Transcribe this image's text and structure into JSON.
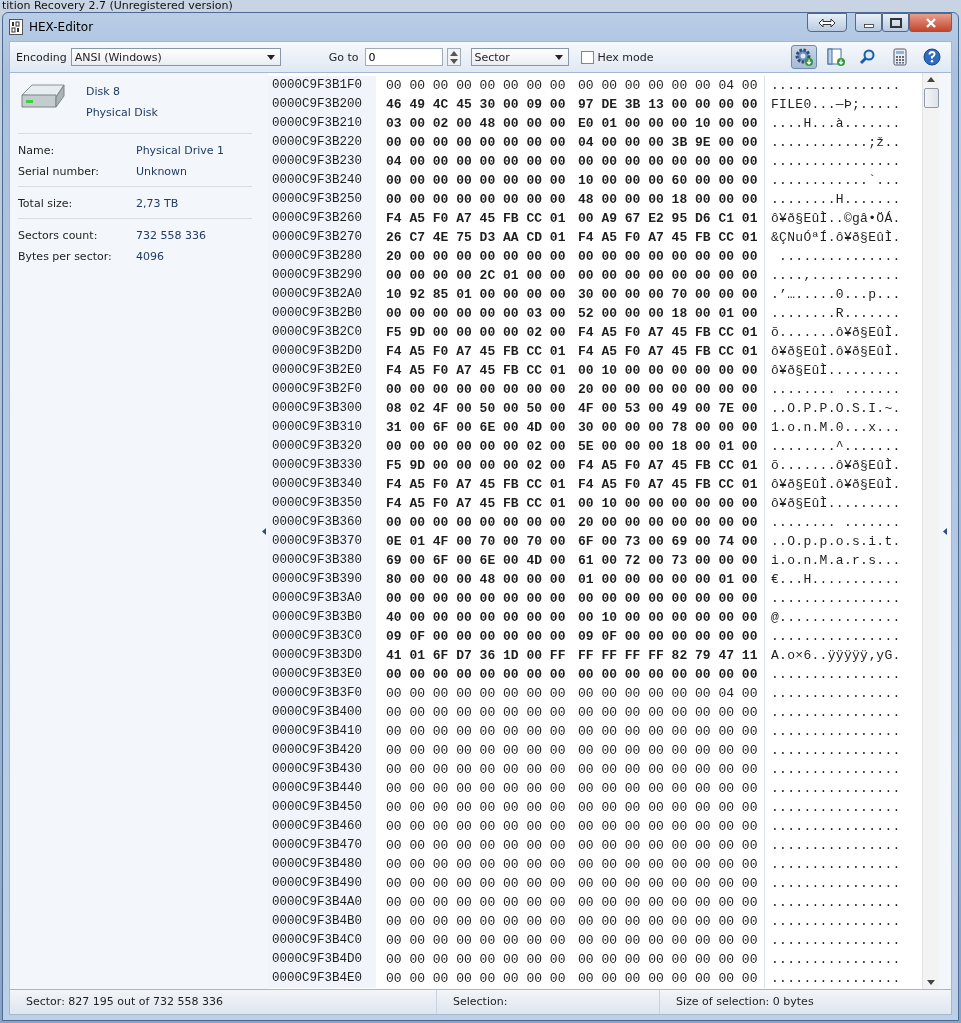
{
  "background_window_title": "tition Recovery 2.7 (Unregistered version)",
  "window": {
    "title": "HEX-Editor"
  },
  "toolbar": {
    "encoding_label": "Encoding",
    "encoding_value": "ANSI (Windows)",
    "goto_label": "Go to",
    "goto_value": "0",
    "unit_value": "Sector",
    "hex_mode": {
      "label": "Hex mode",
      "checked": false
    },
    "icons": [
      {
        "kind": "gear",
        "selected": true
      },
      {
        "kind": "panel",
        "selected": false
      },
      {
        "kind": "search",
        "selected": false
      },
      {
        "kind": "calculator",
        "selected": false
      },
      {
        "kind": "help",
        "selected": false
      }
    ]
  },
  "disk": {
    "title": "Disk 8",
    "subtitle": "Physical Disk",
    "groups": [
      [
        {
          "label": "Name:",
          "value": "Physical Drive 1"
        },
        {
          "label": "Serial number:",
          "value": "Unknown"
        }
      ],
      [
        {
          "label": "Total size:",
          "value": "2,73 TB"
        }
      ],
      [
        {
          "label": "Sectors count:",
          "value": "732 558 336"
        },
        {
          "label": "Bytes per sector:",
          "value": "4096"
        }
      ]
    ]
  },
  "hex_rows": [
    {
      "offset": "0000C9F3B1F0",
      "hex_1": "00 00 00 00 00 00 00 00",
      "hex_2": "00 00 00 00 00 00 04 00",
      "text": "................",
      "bold": false
    },
    {
      "offset": "0000C9F3B200",
      "hex_1": "46 49 4C 45 30 00 09 00",
      "hex_2": "97 DE 3B 13 00 00 00 00",
      "text": "FILE0...—Þ;.....",
      "bold": true
    },
    {
      "offset": "0000C9F3B210",
      "hex_1": "03 00 02 00 48 00 00 00",
      "hex_2": "E0 01 00 00 00 10 00 00",
      "text": "....H...à.......",
      "bold": true
    },
    {
      "offset": "0000C9F3B220",
      "hex_1": "00 00 00 00 00 00 00 00",
      "hex_2": "04 00 00 00 3B 9E 00 00",
      "text": "............;ž..",
      "bold": true
    },
    {
      "offset": "0000C9F3B230",
      "hex_1": "04 00 00 00 00 00 00 00",
      "hex_2": "00 00 00 00 00 00 00 00",
      "text": "................",
      "bold": true
    },
    {
      "offset": "0000C9F3B240",
      "hex_1": "00 00 00 00 00 00 00 00",
      "hex_2": "10 00 00 00 60 00 00 00",
      "text": "............`...",
      "bold": true
    },
    {
      "offset": "0000C9F3B250",
      "hex_1": "00 00 00 00 00 00 00 00",
      "hex_2": "48 00 00 00 18 00 00 00",
      "text": "........H.......",
      "bold": true
    },
    {
      "offset": "0000C9F3B260",
      "hex_1": "F4 A5 F0 A7 45 FB CC 01",
      "hex_2": "00 A9 67 E2 95 D6 C1 01",
      "text": "ô¥ð§EûÌ..©gâ•ÖÁ.",
      "bold": true
    },
    {
      "offset": "0000C9F3B270",
      "hex_1": "26 C7 4E 75 D3 AA CD 01",
      "hex_2": "F4 A5 F0 A7 45 FB CC 01",
      "text": "&ÇNuÓªÍ.ô¥ð§EûÌ.",
      "bold": true
    },
    {
      "offset": "0000C9F3B280",
      "hex_1": "20 00 00 00 00 00 00 00",
      "hex_2": "00 00 00 00 00 00 00 00",
      "text": " ...............",
      "bold": true
    },
    {
      "offset": "0000C9F3B290",
      "hex_1": "00 00 00 00 2C 01 00 00",
      "hex_2": "00 00 00 00 00 00 00 00",
      "text": "....,...........",
      "bold": true
    },
    {
      "offset": "0000C9F3B2A0",
      "hex_1": "10 92 85 01 00 00 00 00",
      "hex_2": "30 00 00 00 70 00 00 00",
      "text": ".’….....0...p...",
      "bold": true
    },
    {
      "offset": "0000C9F3B2B0",
      "hex_1": "00 00 00 00 00 00 03 00",
      "hex_2": "52 00 00 00 18 00 01 00",
      "text": "........R.......",
      "bold": true
    },
    {
      "offset": "0000C9F3B2C0",
      "hex_1": "F5 9D 00 00 00 00 02 00",
      "hex_2": "F4 A5 F0 A7 45 FB CC 01",
      "text": "õ.......ô¥ð§EûÌ.",
      "bold": true
    },
    {
      "offset": "0000C9F3B2D0",
      "hex_1": "F4 A5 F0 A7 45 FB CC 01",
      "hex_2": "F4 A5 F0 A7 45 FB CC 01",
      "text": "ô¥ð§EûÌ.ô¥ð§EûÌ.",
      "bold": true
    },
    {
      "offset": "0000C9F3B2E0",
      "hex_1": "F4 A5 F0 A7 45 FB CC 01",
      "hex_2": "00 10 00 00 00 00 00 00",
      "text": "ô¥ð§EûÌ.........",
      "bold": true
    },
    {
      "offset": "0000C9F3B2F0",
      "hex_1": "00 00 00 00 00 00 00 00",
      "hex_2": "20 00 00 00 00 00 00 00",
      "text": "........ .......",
      "bold": true
    },
    {
      "offset": "0000C9F3B300",
      "hex_1": "08 02 4F 00 50 00 50 00",
      "hex_2": "4F 00 53 00 49 00 7E 00",
      "text": "..O.P.P.O.S.I.~.",
      "bold": true
    },
    {
      "offset": "0000C9F3B310",
      "hex_1": "31 00 6F 00 6E 00 4D 00",
      "hex_2": "30 00 00 00 78 00 00 00",
      "text": "1.o.n.M.0...x...",
      "bold": true
    },
    {
      "offset": "0000C9F3B320",
      "hex_1": "00 00 00 00 00 00 02 00",
      "hex_2": "5E 00 00 00 18 00 01 00",
      "text": "........^.......",
      "bold": true
    },
    {
      "offset": "0000C9F3B330",
      "hex_1": "F5 9D 00 00 00 00 02 00",
      "hex_2": "F4 A5 F0 A7 45 FB CC 01",
      "text": "õ.......ô¥ð§EûÌ.",
      "bold": true
    },
    {
      "offset": "0000C9F3B340",
      "hex_1": "F4 A5 F0 A7 45 FB CC 01",
      "hex_2": "F4 A5 F0 A7 45 FB CC 01",
      "text": "ô¥ð§EûÌ.ô¥ð§EûÌ.",
      "bold": true
    },
    {
      "offset": "0000C9F3B350",
      "hex_1": "F4 A5 F0 A7 45 FB CC 01",
      "hex_2": "00 10 00 00 00 00 00 00",
      "text": "ô¥ð§EûÌ.........",
      "bold": true
    },
    {
      "offset": "0000C9F3B360",
      "hex_1": "00 00 00 00 00 00 00 00",
      "hex_2": "20 00 00 00 00 00 00 00",
      "text": "........ .......",
      "bold": true
    },
    {
      "offset": "0000C9F3B370",
      "hex_1": "0E 01 4F 00 70 00 70 00",
      "hex_2": "6F 00 73 00 69 00 74 00",
      "text": "..O.p.p.o.s.i.t.",
      "bold": true
    },
    {
      "offset": "0000C9F3B380",
      "hex_1": "69 00 6F 00 6E 00 4D 00",
      "hex_2": "61 00 72 00 73 00 00 00",
      "text": "i.o.n.M.a.r.s...",
      "bold": true
    },
    {
      "offset": "0000C9F3B390",
      "hex_1": "80 00 00 00 48 00 00 00",
      "hex_2": "01 00 00 00 00 00 01 00",
      "text": "€...H...........",
      "bold": true
    },
    {
      "offset": "0000C9F3B3A0",
      "hex_1": "00 00 00 00 00 00 00 00",
      "hex_2": "00 00 00 00 00 00 00 00",
      "text": "................",
      "bold": true
    },
    {
      "offset": "0000C9F3B3B0",
      "hex_1": "40 00 00 00 00 00 00 00",
      "hex_2": "00 10 00 00 00 00 00 00",
      "text": "@...............",
      "bold": true
    },
    {
      "offset": "0000C9F3B3C0",
      "hex_1": "09 0F 00 00 00 00 00 00",
      "hex_2": "09 0F 00 00 00 00 00 00",
      "text": "................",
      "bold": true
    },
    {
      "offset": "0000C9F3B3D0",
      "hex_1": "41 01 6F D7 36 1D 00 FF",
      "hex_2": "FF FF FF FF 82 79 47 11",
      "text": "A.o×6..ÿÿÿÿÿ‚yG.",
      "bold": true
    },
    {
      "offset": "0000C9F3B3E0",
      "hex_1": "00 00 00 00 00 00 00 00",
      "hex_2": "00 00 00 00 00 00 00 00",
      "text": "................",
      "bold": true
    },
    {
      "offset": "0000C9F3B3F0",
      "hex_1": "00 00 00 00 00 00 00 00",
      "hex_2": "00 00 00 00 00 00 04 00",
      "text": "................",
      "bold": false
    },
    {
      "offset": "0000C9F3B400",
      "hex_1": "00 00 00 00 00 00 00 00",
      "hex_2": "00 00 00 00 00 00 00 00",
      "text": "................",
      "bold": false
    },
    {
      "offset": "0000C9F3B410",
      "hex_1": "00 00 00 00 00 00 00 00",
      "hex_2": "00 00 00 00 00 00 00 00",
      "text": "................",
      "bold": false
    },
    {
      "offset": "0000C9F3B420",
      "hex_1": "00 00 00 00 00 00 00 00",
      "hex_2": "00 00 00 00 00 00 00 00",
      "text": "................",
      "bold": false
    },
    {
      "offset": "0000C9F3B430",
      "hex_1": "00 00 00 00 00 00 00 00",
      "hex_2": "00 00 00 00 00 00 00 00",
      "text": "................",
      "bold": false
    },
    {
      "offset": "0000C9F3B440",
      "hex_1": "00 00 00 00 00 00 00 00",
      "hex_2": "00 00 00 00 00 00 00 00",
      "text": "................",
      "bold": false
    },
    {
      "offset": "0000C9F3B450",
      "hex_1": "00 00 00 00 00 00 00 00",
      "hex_2": "00 00 00 00 00 00 00 00",
      "text": "................",
      "bold": false
    },
    {
      "offset": "0000C9F3B460",
      "hex_1": "00 00 00 00 00 00 00 00",
      "hex_2": "00 00 00 00 00 00 00 00",
      "text": "................",
      "bold": false
    },
    {
      "offset": "0000C9F3B470",
      "hex_1": "00 00 00 00 00 00 00 00",
      "hex_2": "00 00 00 00 00 00 00 00",
      "text": "................",
      "bold": false
    },
    {
      "offset": "0000C9F3B480",
      "hex_1": "00 00 00 00 00 00 00 00",
      "hex_2": "00 00 00 00 00 00 00 00",
      "text": "................",
      "bold": false
    },
    {
      "offset": "0000C9F3B490",
      "hex_1": "00 00 00 00 00 00 00 00",
      "hex_2": "00 00 00 00 00 00 00 00",
      "text": "................",
      "bold": false
    },
    {
      "offset": "0000C9F3B4A0",
      "hex_1": "00 00 00 00 00 00 00 00",
      "hex_2": "00 00 00 00 00 00 00 00",
      "text": "................",
      "bold": false
    },
    {
      "offset": "0000C9F3B4B0",
      "hex_1": "00 00 00 00 00 00 00 00",
      "hex_2": "00 00 00 00 00 00 00 00",
      "text": "................",
      "bold": false
    },
    {
      "offset": "0000C9F3B4C0",
      "hex_1": "00 00 00 00 00 00 00 00",
      "hex_2": "00 00 00 00 00 00 00 00",
      "text": "................",
      "bold": false
    },
    {
      "offset": "0000C9F3B4D0",
      "hex_1": "00 00 00 00 00 00 00 00",
      "hex_2": "00 00 00 00 00 00 00 00",
      "text": "................",
      "bold": false
    },
    {
      "offset": "0000C9F3B4E0",
      "hex_1": "00 00 00 00 00 00 00 00",
      "hex_2": "00 00 00 00 00 00 00 00",
      "text": "................",
      "bold": false
    }
  ],
  "status_bar": [
    "Sector: 827 195 out of 732 558 336",
    "Selection:",
    "Size of selection: 0 bytes"
  ]
}
